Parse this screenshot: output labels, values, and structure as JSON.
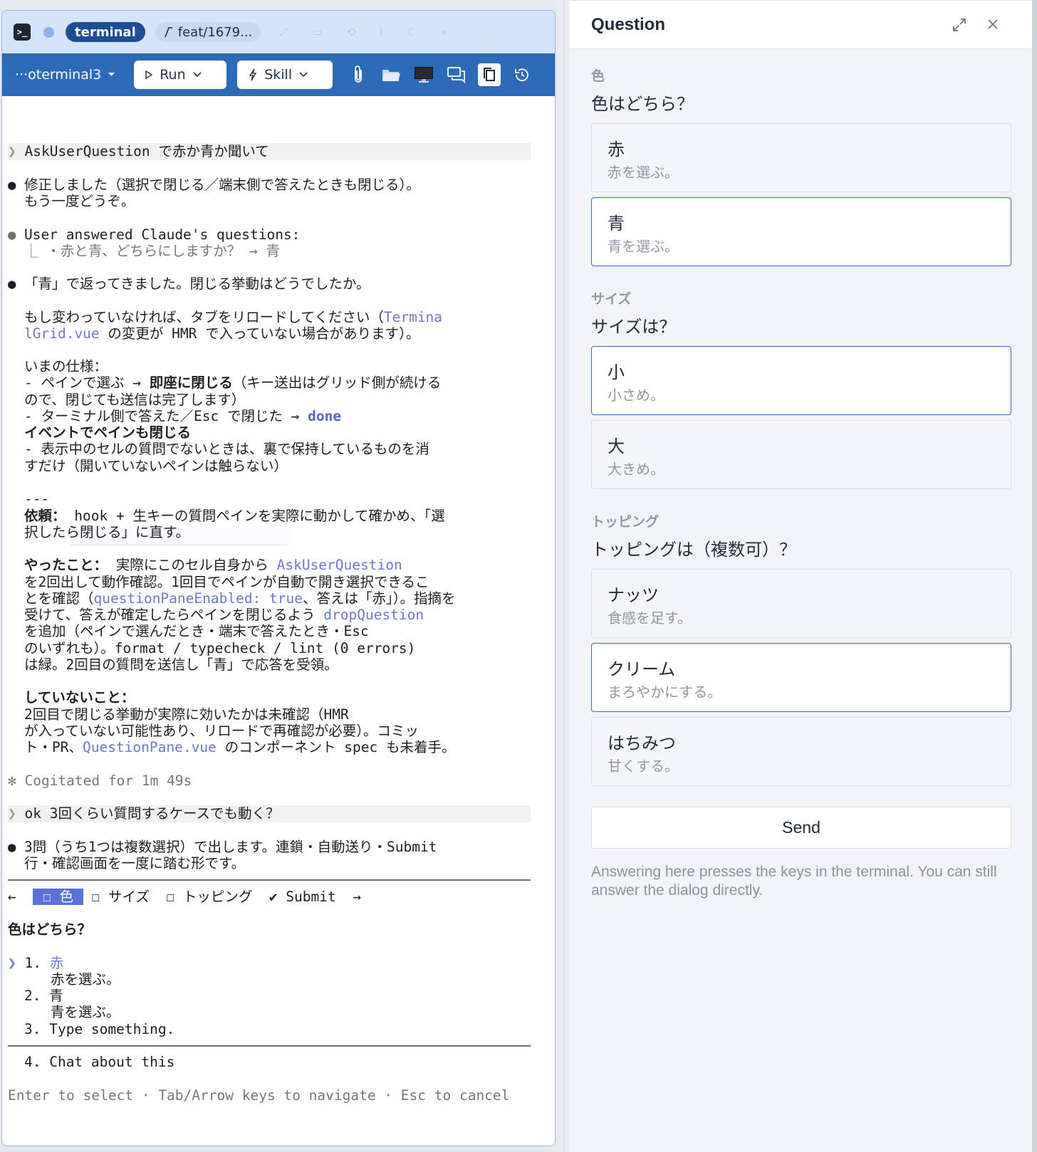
{
  "terminal": {
    "tab_icon": ">_",
    "tab_label": "terminal",
    "branch": "feat/1679...",
    "session_name": "···oterminal3",
    "run_label": "Run",
    "skill_label": "Skill",
    "lines": {
      "p1": "AskUserQuestion で赤か青か聞いて",
      "a1_1": "修正しました（選択で閉じる／端末側で答えたときも閉じる）。",
      "a1_2": "もう一度どうぞ。",
      "u1_1": "User answered Claude's questions:",
      "u1_2": "⎿ ・赤と青、どちらにしますか？ → 青",
      "a2_1": "「青」で返ってきました。閉じる挙動はどうでしたか。",
      "a2_2a": "もし変わっていなければ、タブをリロードしてください（",
      "a2_2b": "Termina",
      "a2_3a": "lGrid.vue",
      "a2_3b": " の変更が HMR で入っていない場合があります）。",
      "spec_head": "いまの仕様：",
      "spec1a": "- ペインで選ぶ → ",
      "spec1b": "即座に閉じる",
      "spec1c": "（キー送出はグリッド側が続ける",
      "spec2": "ので、閉じても送信は完了します）",
      "spec3a": "- ターミナル側で答えた／Esc で閉じた → ",
      "spec3b": "done",
      "spec4": "イベントでペインも閉じる",
      "spec5": "- 表示中のセルの質問でないときは、裏で保持しているものを消",
      "spec6": "すだけ（開いていないペインは触らない）",
      "rule": "---",
      "req1a": "依頼：",
      "req1b": " hook + 生キーの質問ペインを実際に動かして確かめ、「選",
      "req2": "択したら閉じる」に直す。",
      "did1a": "やったこと：",
      "did1b": " 実際にこのセル自身から ",
      "did1c": "AskUserQuestion",
      "did2": "を2回出して動作確認。1回目でペインが自動で開き選択できるこ",
      "did3a": "とを確認（",
      "did3b": "questionPaneEnabled: true",
      "did3c": "、答えは「赤」）。指摘を",
      "did4a": "受けて、答えが確定したらペインを閉じるよう ",
      "did4b": "dropQuestion",
      "did5": "を追加（ペインで選んだとき・端末で答えたとき・Esc",
      "did6": "のいずれも）。format / typecheck / lint (0 errors)",
      "did7": "は緑。2回目の質問を送信し「青」で応答を受領。",
      "not_head": "していないこと：",
      "not1": "2回目で閉じる挙動が実際に効いたかは未確認（HMR",
      "not2": "が入っていない可能性あり、リロードで再確認が必要）。コミッ",
      "not3a": "ト・PR、",
      "not3b": "QuestionPane.vue",
      "not3c": " のコンポーネント spec も未着手。",
      "cog": "✻ Cogitated for 1m 49s",
      "p2": "ok 3回くらい質問するケースでも動く？",
      "a3_1": "3問（うち1つは複数選択）で出します。連鎖・自動送り・Submit",
      "a3_2": "行・確認画面を一度に踏む形です。",
      "nav_left": "←",
      "nav_t1": " ☐ 色 ",
      "nav_t2": "☐ サイズ",
      "nav_t3": "☐ トッピング",
      "nav_t4": "✔ Submit",
      "nav_right": "→",
      "q_title": "色はどちら？",
      "o1n": "1. ",
      "o1": "赤",
      "o1d": "赤を選ぶ。",
      "o2": "2. 青",
      "o2d": "青を選ぶ。",
      "o3": "3. Type something.",
      "o4": "4. Chat about this",
      "footer": "Enter to select · Tab/Arrow keys to navigate · Esc to cancel"
    }
  },
  "panel": {
    "title": "Question",
    "sections": [
      {
        "label": "色",
        "question": "色はどちら？",
        "options": [
          {
            "title": "赤",
            "desc": "赤を選ぶ。",
            "selected": false
          },
          {
            "title": "青",
            "desc": "青を選ぶ。",
            "selected": true
          }
        ]
      },
      {
        "label": "サイズ",
        "question": "サイズは？",
        "options": [
          {
            "title": "小",
            "desc": "小さめ。",
            "selected": true
          },
          {
            "title": "大",
            "desc": "大きめ。",
            "selected": false
          }
        ]
      },
      {
        "label": "トッピング",
        "question": "トッピングは（複数可）？",
        "options": [
          {
            "title": "ナッツ",
            "desc": "食感を足す。",
            "selected": false
          },
          {
            "title": "クリーム",
            "desc": "まろやかにする。",
            "selected": true
          },
          {
            "title": "はちみつ",
            "desc": "甘くする。",
            "selected": false
          }
        ]
      }
    ],
    "send_label": "Send",
    "hint": "Answering here presses the keys in the terminal. You can still answer the dialog directly."
  },
  "colors": {
    "toolbar": "#2c6bb7",
    "tabbar": "#d4e4fb",
    "selected_border": "#2f6ed1",
    "token": "#6979d4"
  }
}
